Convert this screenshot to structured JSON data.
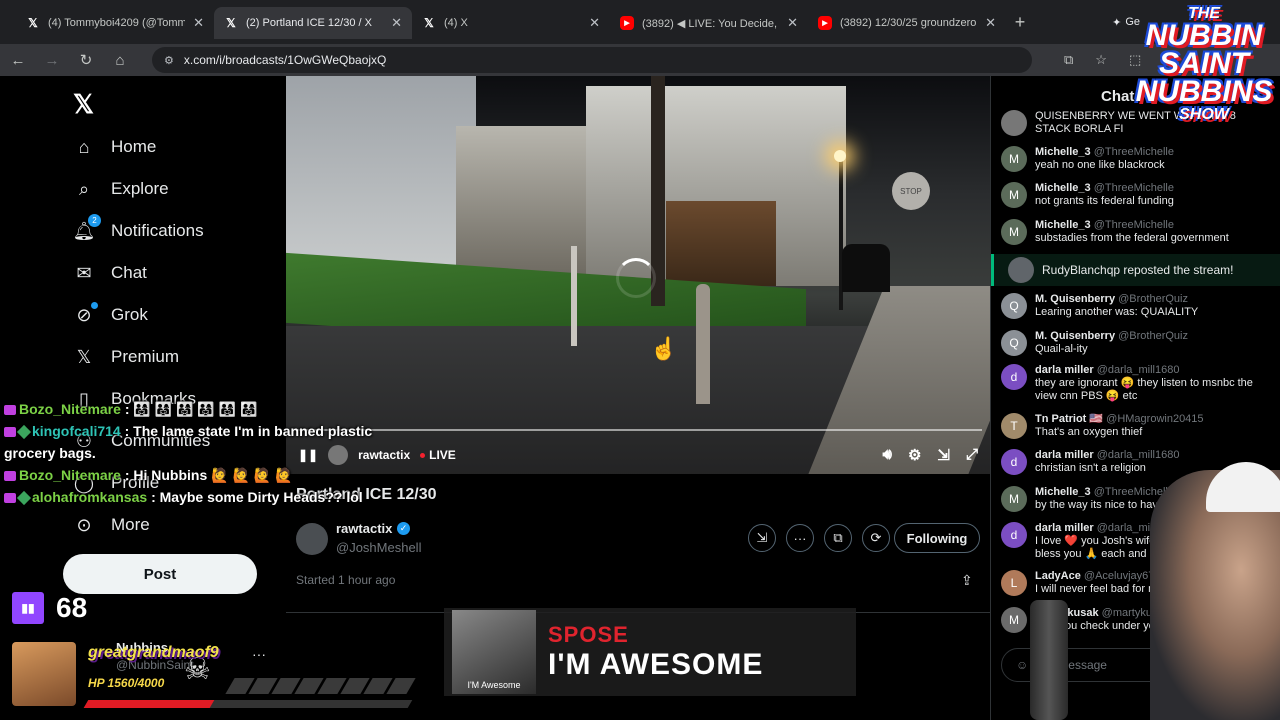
{
  "browser": {
    "tabs": [
      {
        "title": "(4) Tommyboi4209 (@Tommy4",
        "icon": "x-icon"
      },
      {
        "title": "(2) Portland ICE 12/30 / X",
        "icon": "x-icon"
      },
      {
        "title": "(4) X",
        "icon": "x-icon"
      },
      {
        "title": "(3892) ◀ LIVE: You Decide, Has",
        "icon": "youtube-icon"
      },
      {
        "title": "(3892) 12/30/25 groundzeropd",
        "icon": "youtube-icon"
      }
    ],
    "gemini_label": "Ge",
    "url": "x.com/i/broadcasts/1OwGWeQbaojxQ"
  },
  "sidebar": {
    "items": [
      {
        "label": "Home"
      },
      {
        "label": "Explore"
      },
      {
        "label": "Notifications",
        "badge": "2"
      },
      {
        "label": "Chat"
      },
      {
        "label": "Grok"
      },
      {
        "label": "Premium"
      },
      {
        "label": "Bookmarks"
      },
      {
        "label": "Communities"
      },
      {
        "label": "Profile"
      },
      {
        "label": "More"
      }
    ],
    "post_label": "Post",
    "account_name": "Nubbins",
    "account_handle": "@NubbinSaint"
  },
  "video": {
    "channel": "rawtactix",
    "live_label": "LIVE",
    "stop_sign_text": "STOP"
  },
  "broadcast": {
    "title": "Portland ICE 12/30",
    "name": "rawtactix",
    "handle": "@JoshMeshell",
    "follow_label": "Following",
    "started": "Started 1 hour ago"
  },
  "chat": {
    "header": "Chat",
    "top_text": "QUISENBERRY WE WENT WITH THE 8 STACK BORLA FI",
    "messages": [
      {
        "name": "Michelle_3",
        "handle": "@ThreeMichelle",
        "text": "yeah no one like blackrock",
        "avatar": "M"
      },
      {
        "name": "Michelle_3",
        "handle": "@ThreeMichelle",
        "text": "not grants its federal funding",
        "avatar": "M"
      },
      {
        "name": "Michelle_3",
        "handle": "@ThreeMichelle",
        "text": "substadies from the federal government",
        "avatar": "M"
      },
      {
        "name": "M. Quisenberry",
        "handle": "@BrotherQuiz",
        "text": "Learing     another was:  QUAIALITY",
        "avatar": "Q"
      },
      {
        "name": "M. Quisenberry",
        "handle": "@BrotherQuiz",
        "text": "Quail-al-ity",
        "avatar": "Q"
      },
      {
        "name": "darla miller",
        "handle": "@darla_mill1680",
        "text": "they are ignorant 😝 they listen to msnbc the view  cnn PBS 😝 etc",
        "avatar": "d"
      },
      {
        "name": "Tn Patriot 🇺🇸",
        "handle": "@HMagrowin20415",
        "text": "That's an oxygen thief",
        "avatar": "T"
      },
      {
        "name": "darla miller",
        "handle": "@darla_mill1680",
        "text": "christian isn't a religion",
        "avatar": "d"
      },
      {
        "name": "Michelle_3",
        "handle": "@ThreeMichelle",
        "text": "by the way its nice to have ya out",
        "avatar": "M"
      },
      {
        "name": "darla miller",
        "handle": "@darla_mill1680",
        "text": "I love ❤️ you Josh's wife and Josh may God bless you 🙏 each and every day",
        "avatar": "d"
      },
      {
        "name": "LadyAce",
        "handle": "@Aceluvjay67",
        "text": "I will never feel bad for mace face fuck t",
        "avatar": "L"
      },
      {
        "name": "Marty kusak",
        "handle": "@martykusak",
        "text": "sure you check under yo",
        "avatar": "M"
      }
    ],
    "repost_text": "RudyBlanchqp reposted the stream!",
    "input_placeholder": "d a message"
  },
  "overlay": {
    "chat_lines": [
      {
        "user": "Bozo_Nitemare",
        "text": ": 👨‍👩‍👧 👨‍👩‍👧 👨‍👩‍👧 👨‍👩‍👧 👨‍👩‍👧 👨‍👩‍👧"
      },
      {
        "user": "kingofcali714",
        "text": ": The lame state I'm in banned plastic grocery bags."
      },
      {
        "user": "Bozo_Nitemare",
        "text": ": Hi Nubbins 🙋 🙋 🙋 🙋"
      },
      {
        "user": "alohafromkansas",
        "text": ": Maybe some Dirty Heads?? lol"
      }
    ],
    "viewer_count": "68",
    "hp_user": "greatgrandmaof9",
    "hp_text": "HP 1560/4000",
    "hp_fraction": 0.39,
    "now_playing_artist": "SPOSE",
    "now_playing_song": "I'M AWESOME",
    "cover_text": "I'M Awesome",
    "logo_the": "THE",
    "logo_line1": "NUBBIN",
    "logo_line2": "SAINT",
    "logo_line3": "NUBBINS",
    "logo_show": "SHOW"
  }
}
